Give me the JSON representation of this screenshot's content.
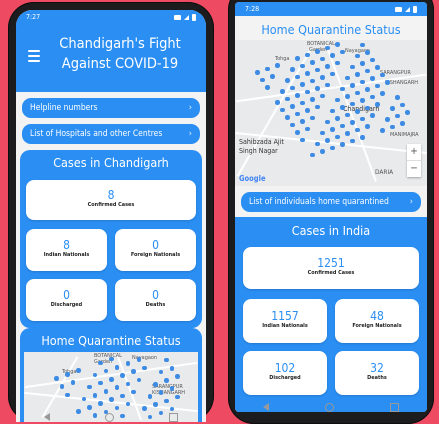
{
  "left": {
    "status_time": "7:27",
    "app_title_line1": "Chandigarh's Fight",
    "app_title_line2": "Against COVID-19",
    "helpline_label": "Helpline numbers",
    "hospitals_label": "List of Hospitals and other Centres",
    "cases_title": "Cases in Chandigarh",
    "confirmed_value": "8",
    "confirmed_label": "Confirmed Cases",
    "indian_value": "8",
    "indian_label": "Indian Nationals",
    "foreign_value": "0",
    "foreign_label": "Foreign Nationals",
    "discharged_value": "0",
    "discharged_label": "Discharged",
    "deaths_value": "0",
    "deaths_label": "Deaths",
    "quarantine_title": "Home Quarantine Status",
    "map_labels": [
      "BOTANICAL",
      "Garden",
      "Nayagaon",
      "Tohga",
      "SARANGPUR",
      "KISHANGARH"
    ]
  },
  "right": {
    "status_time": "7:28",
    "quarantine_title": "Home Quarantine Status",
    "map_labels": [
      "BOTANICAL",
      "Garden",
      "Nayagaon",
      "Tohga",
      "Chandigarh",
      "KISHANGARH",
      "SARANGPUR",
      "Sahibzada Ajit",
      "Singh Nagar",
      "MANIMAJRA",
      "DARIA",
      "Google"
    ],
    "zoom_in": "+",
    "zoom_out": "−",
    "list_label": "List of individuals home quarantined",
    "cases_title": "Cases in India",
    "confirmed_value": "1251",
    "confirmed_label": "Confirmed Cases",
    "indian_value": "1157",
    "indian_label": "Indian Nationals",
    "foreign_value": "48",
    "foreign_label": "Foreign Nationals",
    "discharged_value": "102",
    "discharged_label": "Discharged",
    "deaths_value": "32",
    "deaths_label": "Deaths"
  },
  "colors": {
    "background": "#ee4a62",
    "accent": "#2a8ef3",
    "map_dot": "#3d8be3"
  }
}
